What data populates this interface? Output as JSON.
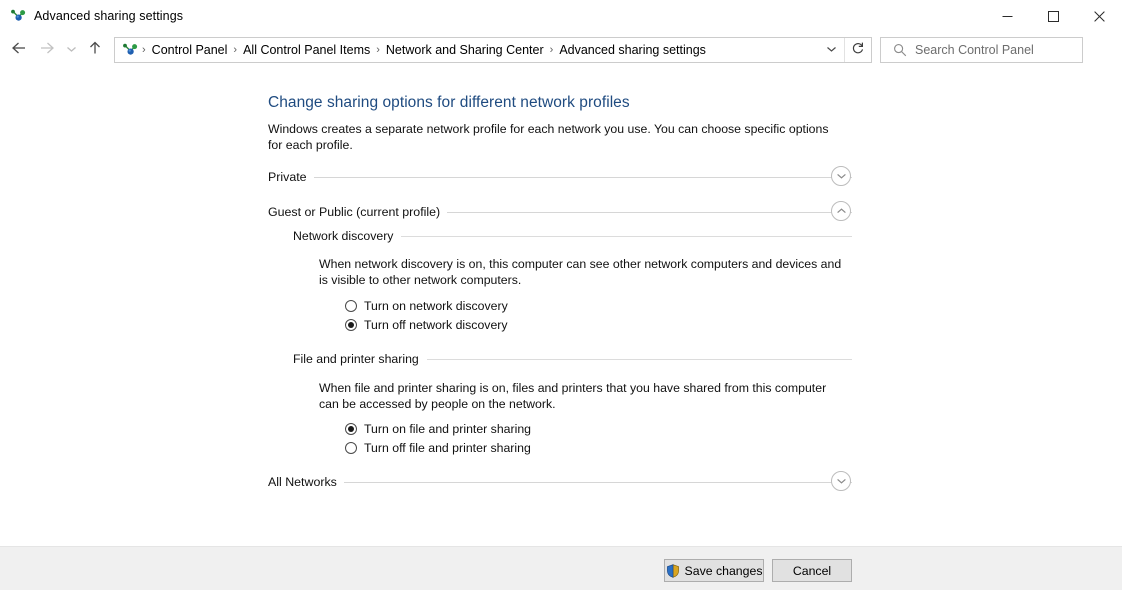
{
  "window": {
    "title": "Advanced sharing settings",
    "icon": "network-sharing-icon",
    "controls": {
      "minimize": "minimize-icon",
      "maximize": "maximize-icon",
      "close": "close-icon"
    }
  },
  "toolbar": {
    "back": "back-arrow-icon",
    "forward": "forward-arrow-icon",
    "recent": "recent-locations-chevron-icon",
    "up": "up-arrow-icon",
    "address_icon": "network-sharing-icon",
    "breadcrumbs": [
      "Control Panel",
      "All Control Panel Items",
      "Network and Sharing Center",
      "Advanced sharing settings"
    ],
    "separator": "›",
    "dropdown": "chevron-down-icon",
    "refresh": "refresh-icon",
    "search": {
      "icon": "search-icon",
      "placeholder": "Search Control Panel",
      "value": ""
    }
  },
  "main": {
    "title": "Change sharing options for different network profiles",
    "description": "Windows creates a separate network profile for each network you use. You can choose specific options for each profile.",
    "groups": [
      {
        "label": "Private",
        "expanded": false,
        "chevron": "chevron-down-icon"
      },
      {
        "label": "Guest or Public (current profile)",
        "expanded": true,
        "chevron": "chevron-up-icon"
      },
      {
        "label": "All Networks",
        "expanded": false,
        "chevron": "chevron-down-icon"
      }
    ],
    "sections": [
      {
        "heading": "Network discovery",
        "description": "When network discovery is on, this computer can see other network computers and devices and is visible to other network computers.",
        "options": [
          {
            "label": "Turn on network discovery",
            "selected": false
          },
          {
            "label": "Turn off network discovery",
            "selected": true
          }
        ]
      },
      {
        "heading": "File and printer sharing",
        "description": "When file and printer sharing is on, files and printers that you have shared from this computer can be accessed by people on the network.",
        "options": [
          {
            "label": "Turn on file and printer sharing",
            "selected": true
          },
          {
            "label": "Turn off file and printer sharing",
            "selected": false
          }
        ]
      }
    ]
  },
  "footer": {
    "save_label": "Save changes",
    "save_icon": "uac-shield-icon",
    "cancel_label": "Cancel"
  },
  "colors": {
    "heading_blue": "#1f4b80",
    "window_bg": "#ffffff",
    "command_bar_bg": "#f0f0f0",
    "button_face": "#e1e1e1",
    "divider": "#d6d6d6"
  }
}
